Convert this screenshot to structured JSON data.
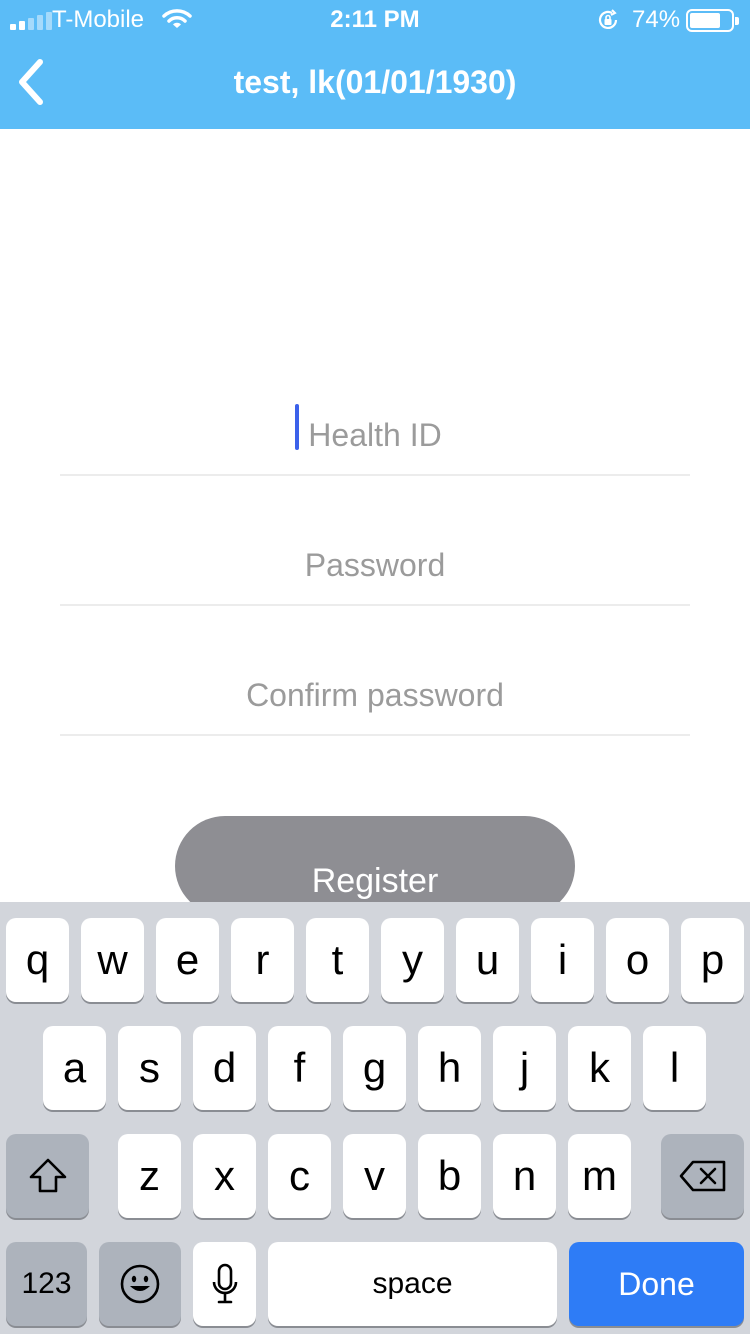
{
  "status_bar": {
    "carrier": "T-Mobile",
    "time": "2:11 PM",
    "battery_percent": "74%",
    "battery_level": 0.74,
    "signal_bars_active": 2,
    "signal_bars_total": 5
  },
  "nav": {
    "title": "test, lk(01/01/1930)",
    "back_icon": "chevron-left-icon"
  },
  "form": {
    "health_id_placeholder": "Health ID",
    "password_placeholder": "Password",
    "confirm_password_placeholder": "Confirm password",
    "register_label": "Register"
  },
  "keyboard": {
    "row1": [
      "q",
      "w",
      "e",
      "r",
      "t",
      "y",
      "u",
      "i",
      "o",
      "p"
    ],
    "row2": [
      "a",
      "s",
      "d",
      "f",
      "g",
      "h",
      "j",
      "k",
      "l"
    ],
    "row3": [
      "z",
      "x",
      "c",
      "v",
      "b",
      "n",
      "m"
    ],
    "numbers_label": "123",
    "space_label": "space",
    "done_label": "Done"
  },
  "colors": {
    "nav_background": "#5bbcf7",
    "register_button": "#8e8e93",
    "done_key": "#2e7cf6",
    "keyboard_background": "#d2d5db",
    "caret": "#3b61ea"
  }
}
